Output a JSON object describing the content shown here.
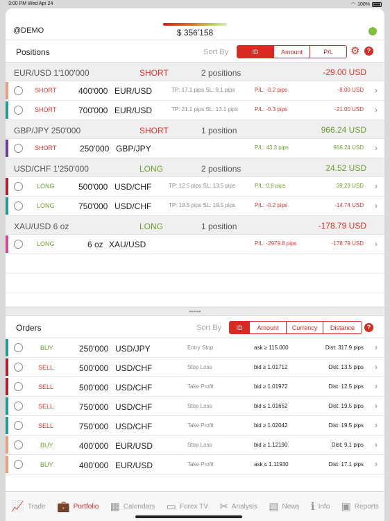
{
  "status": {
    "time": "3:00 PM",
    "date": "Wed Apr 24",
    "battery": "100%"
  },
  "header": {
    "account": "@DEMO",
    "balance": "$ 356'158"
  },
  "positions": {
    "title": "Positions",
    "sort_by": "Sort By",
    "sort_options": [
      "ID",
      "Amount",
      "P/L"
    ],
    "groups": [
      {
        "pair": "EUR/USD 1'100'000",
        "side": "SHORT",
        "count": "2 positions",
        "pl": "-29.00 USD",
        "rows": [
          {
            "side": "SHORT",
            "amount": "400'000",
            "symbol": "EUR/USD",
            "tp_sl": "TP: 17.1 pips SL: 9.1 pips",
            "pl_pips": "P/L: -0.2 pips",
            "pl": "-8.00 USD"
          },
          {
            "side": "SHORT",
            "amount": "700'000",
            "symbol": "EUR/USD",
            "tp_sl": "TP: 21.1 pips SL: 13.1 pips",
            "pl_pips": "P/L: -0.3 pips",
            "pl": "-21.00 USD"
          }
        ]
      },
      {
        "pair": "GBP/JPY 250'000",
        "side": "SHORT",
        "count": "1 position",
        "pl": "966.24 USD",
        "rows": [
          {
            "side": "SHORT",
            "amount": "250'000",
            "symbol": "GBP/JPY",
            "tp_sl": "",
            "pl_pips": "P/L: 43.3 pips",
            "pl": "966.24 USD"
          }
        ]
      },
      {
        "pair": "USD/CHF 1'250'000",
        "side": "LONG",
        "count": "2 positions",
        "pl": "24.52 USD",
        "rows": [
          {
            "side": "LONG",
            "amount": "500'000",
            "symbol": "USD/CHF",
            "tp_sl": "TP: 12.5 pips SL: 13.5 pips",
            "pl_pips": "P/L: 0.8 pips",
            "pl": "39.23 USD"
          },
          {
            "side": "LONG",
            "amount": "750'000",
            "symbol": "USD/CHF",
            "tp_sl": "TP: 19.5 pips SL: 19.5 pips",
            "pl_pips": "P/L: -0.2 pips",
            "pl": "-14.74 USD"
          }
        ]
      },
      {
        "pair": "XAU/USD 6 oz",
        "side": "LONG",
        "count": "1 position",
        "pl": "-178.79 USD",
        "rows": [
          {
            "side": "LONG",
            "amount": "6 oz",
            "symbol": "XAU/USD",
            "tp_sl": "",
            "pl_pips": "P/L: -2979.8 pips",
            "pl": "-178.79 USD"
          }
        ]
      }
    ]
  },
  "orders": {
    "title": "Orders",
    "sort_by": "Sort By",
    "sort_options": [
      "ID",
      "Amount",
      "Currency",
      "Distance"
    ],
    "rows": [
      {
        "side": "BUY",
        "amount": "250'000",
        "symbol": "USD/JPY",
        "type": "Entry Stop",
        "trigger": "ask ≥ 115.000",
        "dist": "Dist: 317.9 pips"
      },
      {
        "side": "SELL",
        "amount": "500'000",
        "symbol": "USD/CHF",
        "type": "Stop Loss",
        "trigger": "bid ≥ 1.01712",
        "dist": "Dist: 13.5 pips"
      },
      {
        "side": "SELL",
        "amount": "500'000",
        "symbol": "USD/CHF",
        "type": "Take Profit",
        "trigger": "bid ≥ 1.01972",
        "dist": "Dist: 12.5 pips"
      },
      {
        "side": "SELL",
        "amount": "750'000",
        "symbol": "USD/CHF",
        "type": "Stop Loss",
        "trigger": "bid ≤ 1.01652",
        "dist": "Dist: 19.5 pips"
      },
      {
        "side": "SELL",
        "amount": "750'000",
        "symbol": "USD/CHF",
        "type": "Take Profit",
        "trigger": "bid ≥ 1.02042",
        "dist": "Dist: 19.5 pips"
      },
      {
        "side": "BUY",
        "amount": "400'000",
        "symbol": "EUR/USD",
        "type": "Stop Loss",
        "trigger": "bid ≥ 1.12190",
        "dist": "Dist: 9.1 pips"
      },
      {
        "side": "BUY",
        "amount": "400'000",
        "symbol": "EUR/USD",
        "type": "Take Profit",
        "trigger": "ask ≤ 1.11930",
        "dist": "Dist: 17.1 pips"
      }
    ]
  },
  "tabs": [
    {
      "label": "Trade",
      "icon": "chart-icon"
    },
    {
      "label": "Portfolio",
      "icon": "briefcase-icon",
      "active": true
    },
    {
      "label": "Calendars",
      "icon": "calendar-icon"
    },
    {
      "label": "Forex TV",
      "icon": "tv-icon"
    },
    {
      "label": "Analysis",
      "icon": "tools-icon"
    },
    {
      "label": "News",
      "icon": "news-icon"
    },
    {
      "label": "Info",
      "icon": "info-icon"
    },
    {
      "label": "Reports",
      "icon": "report-icon"
    }
  ],
  "colors": {
    "accent": "#d82a20",
    "short": "#e0322b",
    "long": "#6f9e2f",
    "online": "#7fbf3f"
  }
}
